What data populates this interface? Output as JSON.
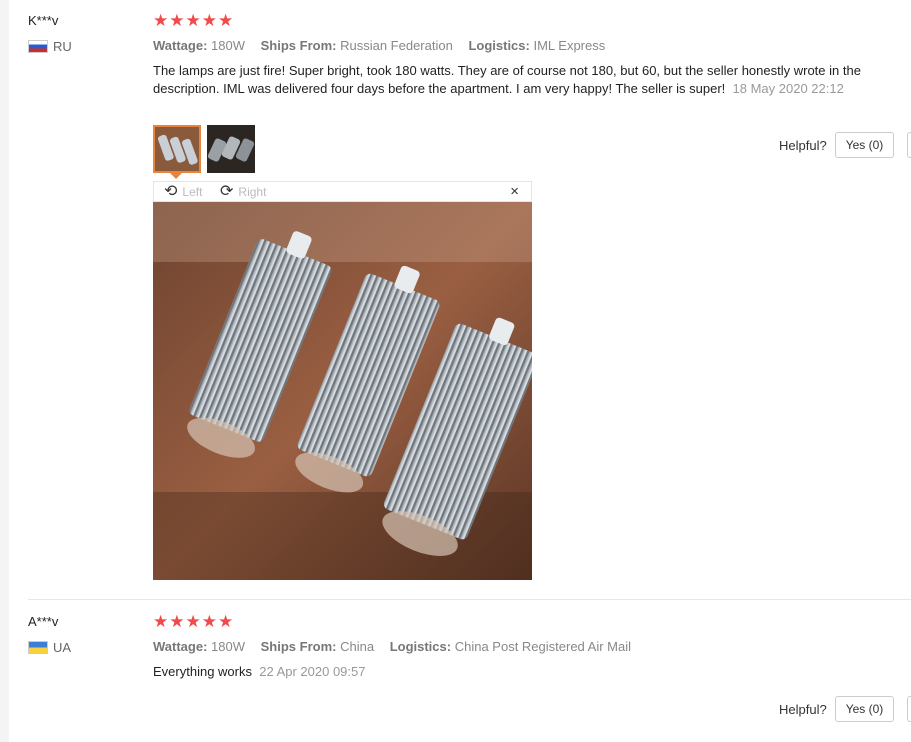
{
  "reviews": [
    {
      "user": "K***v",
      "country": "RU",
      "stars": "★★★★★",
      "attrs": [
        {
          "key": "Wattage:",
          "value": "180W"
        },
        {
          "key": "Ships From:",
          "value": "Russian Federation"
        },
        {
          "key": "Logistics:",
          "value": "IML Express"
        }
      ],
      "text": "The lamps are just fire! Super bright, took 180 watts. They are of course not 180, but 60, but the seller honestly wrote in the description. IML was delivered four days before the apartment. I am very happy! The seller is super!",
      "date": "18 May 2020 22:12",
      "helpful_label": "Helpful?",
      "yes_label": "Yes (0)"
    },
    {
      "user": "A***v",
      "country": "UA",
      "stars": "★★★★★",
      "attrs": [
        {
          "key": "Wattage:",
          "value": "180W"
        },
        {
          "key": "Ships From:",
          "value": "China"
        },
        {
          "key": "Logistics:",
          "value": "China Post Registered Air Mail"
        }
      ],
      "text": "Everything works",
      "date": "22 Apr 2020 09:57",
      "helpful_label": "Helpful?",
      "yes_label": "Yes (0)"
    }
  ],
  "viewer": {
    "left_label": "Left",
    "right_label": "Right",
    "close": "×"
  },
  "icons": {
    "rotate_left": "rotate-left-icon",
    "rotate_right": "rotate-right-icon",
    "close": "close-icon"
  },
  "colors": {
    "star": "#f04a4a",
    "active_thumb": "#e8853b"
  }
}
